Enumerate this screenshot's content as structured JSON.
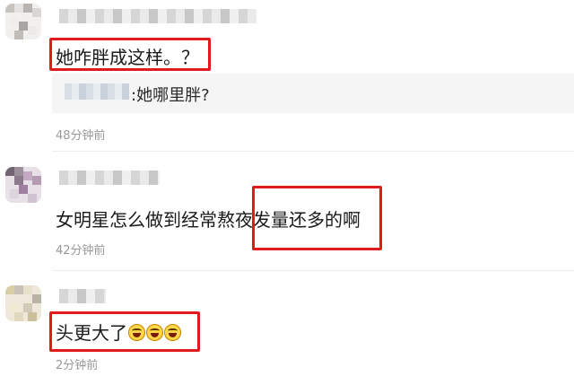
{
  "comments": [
    {
      "text": "她咋胖成这样。？",
      "reply": {
        "text": ":她哪里胖?"
      },
      "time": "48分钟前"
    },
    {
      "text": "女明星怎么做到经常熬夜发量还多的啊",
      "time": "42分钟前"
    },
    {
      "text": "头更大了",
      "emoji_count": 3,
      "emoji_icon": "laughing-tears-emoji-icon",
      "time": "2分钟前"
    }
  ],
  "colors": {
    "highlight": "#e11b1b",
    "time": "#999999",
    "reply_bg": "#f5f5f5"
  }
}
